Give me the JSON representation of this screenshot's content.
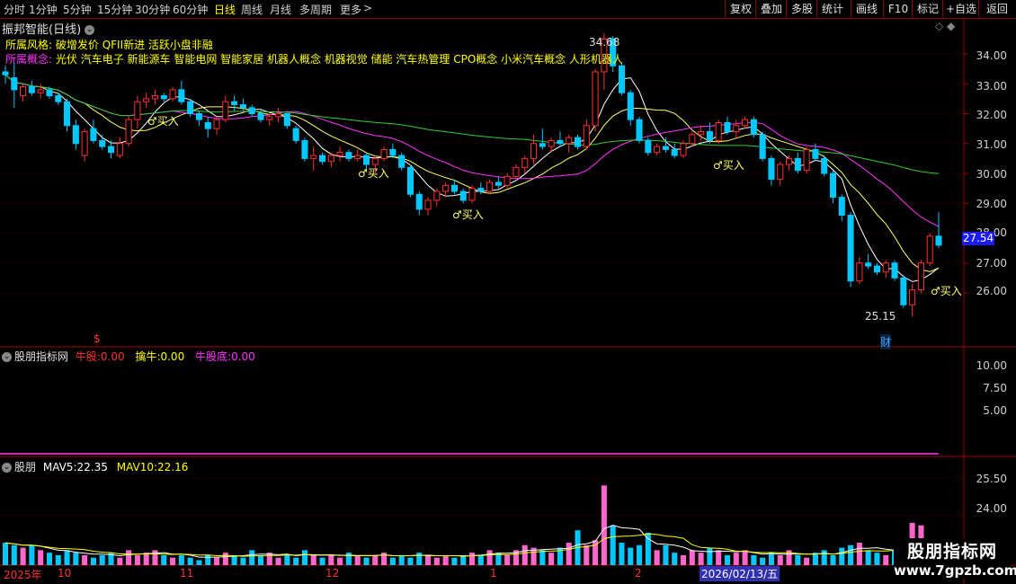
{
  "periods": [
    "分时",
    "1分钟",
    "5分钟",
    "15分钟",
    "30分钟",
    "60分钟",
    "日线",
    "周线",
    "月线",
    "多周期",
    "更多"
  ],
  "active_period": "日线",
  "toolbar": [
    "复权",
    "叠加",
    "多股",
    "统计",
    "画线",
    "F10",
    "标记",
    "+自选",
    "返回"
  ],
  "stock_title": "振邦智能(日线)",
  "style_label": "所属风格:",
  "style_value": "破增发价 QFII新进 活跃小盘非融",
  "concept_label": "所属概念:",
  "concept_value": "光伏 汽车电子 新能源车 智能电网 智能家居 机器人概念 机器视觉 储能 汽车热管理 CPO概念 小米汽车概念 人形机器人",
  "price_axis": [
    "34.00",
    "33.00",
    "32.00",
    "31.00",
    "30.00",
    "29.00",
    "28.00",
    "27.00",
    "26.00"
  ],
  "current_price": "27.54",
  "high_label": "34.68",
  "low_label": "25.15",
  "buy_label": "♂买入",
  "cai_label": "财",
  "s_marker": "$",
  "ind1": {
    "name": "股朋指标网",
    "k1": "牛股:",
    "v1": "0.00",
    "k2": "擒牛:",
    "v2": "0.00",
    "k3": "牛股底:",
    "v3": "0.00",
    "axis": [
      "10.00",
      "7.50",
      "5.00"
    ]
  },
  "ind2": {
    "name": "股朋",
    "k1": "MAV5:",
    "v1": "22.35",
    "k2": "MAV10:",
    "v2": "22.16",
    "axis": [
      "25.50",
      "24.00"
    ]
  },
  "dates": [
    "2025年",
    "10",
    "11",
    "12",
    "1",
    "2",
    "2026/02/13/五"
  ],
  "watermark": {
    "line1": "股朋指标网",
    "line2": "www.7gpzb.com"
  },
  "colors": {
    "up": "#ff3030",
    "down": "#00c8ff",
    "ma_fast": "#ffffff",
    "ma_mid": "#ffff66",
    "ma_slow": "#ff33ff",
    "ma_long": "#33cc33"
  },
  "chart_data": {
    "type": "candlestick",
    "price_range": [
      25.0,
      34.9
    ],
    "candles": [
      [
        33.4,
        33.6,
        33.0,
        33.3
      ],
      [
        33.2,
        33.7,
        32.2,
        32.8
      ],
      [
        32.6,
        33.0,
        32.4,
        32.9
      ],
      [
        32.9,
        33.1,
        32.6,
        32.7
      ],
      [
        32.7,
        33.0,
        32.5,
        32.8
      ],
      [
        32.8,
        32.9,
        32.5,
        32.6
      ],
      [
        32.6,
        32.7,
        32.3,
        32.4
      ],
      [
        32.4,
        32.5,
        31.4,
        31.6
      ],
      [
        31.6,
        31.8,
        30.8,
        31.0
      ],
      [
        30.6,
        31.5,
        30.4,
        31.4
      ],
      [
        31.5,
        31.8,
        31.0,
        31.1
      ],
      [
        31.1,
        31.3,
        30.8,
        30.9
      ],
      [
        30.9,
        31.1,
        30.5,
        30.7
      ],
      [
        30.6,
        31.2,
        30.5,
        31.0
      ],
      [
        31.0,
        31.9,
        30.9,
        31.8
      ],
      [
        31.8,
        32.6,
        31.5,
        32.4
      ],
      [
        32.4,
        32.7,
        32.2,
        32.5
      ],
      [
        32.5,
        32.8,
        32.3,
        32.6
      ],
      [
        32.6,
        32.7,
        32.4,
        32.5
      ],
      [
        32.5,
        32.9,
        32.4,
        32.8
      ],
      [
        32.8,
        33.1,
        32.3,
        32.4
      ],
      [
        32.4,
        32.5,
        31.9,
        32.0
      ],
      [
        32.0,
        32.1,
        31.6,
        31.8
      ],
      [
        31.7,
        31.9,
        31.2,
        31.5
      ],
      [
        31.5,
        31.9,
        31.3,
        31.8
      ],
      [
        31.8,
        32.6,
        31.7,
        32.4
      ],
      [
        32.4,
        32.6,
        32.1,
        32.3
      ],
      [
        32.3,
        32.5,
        32.1,
        32.2
      ],
      [
        32.2,
        32.3,
        31.9,
        32.0
      ],
      [
        32.0,
        32.1,
        31.7,
        31.8
      ],
      [
        31.8,
        32.0,
        31.6,
        31.9
      ],
      [
        31.9,
        32.2,
        31.7,
        32.0
      ],
      [
        32.0,
        32.0,
        31.5,
        31.6
      ],
      [
        31.5,
        31.6,
        31.0,
        31.1
      ],
      [
        31.1,
        31.2,
        30.4,
        30.5
      ],
      [
        30.5,
        30.9,
        30.1,
        30.6
      ],
      [
        30.6,
        30.7,
        30.3,
        30.4
      ],
      [
        30.4,
        30.7,
        30.2,
        30.6
      ],
      [
        30.6,
        30.9,
        30.4,
        30.7
      ],
      [
        30.7,
        30.8,
        30.4,
        30.5
      ],
      [
        30.5,
        30.8,
        30.4,
        30.6
      ],
      [
        30.6,
        30.7,
        30.1,
        30.3
      ],
      [
        30.3,
        30.6,
        30.0,
        30.5
      ],
      [
        30.5,
        30.9,
        30.4,
        30.8
      ],
      [
        30.8,
        31.0,
        30.5,
        30.6
      ],
      [
        30.6,
        30.7,
        30.1,
        30.2
      ],
      [
        30.2,
        30.3,
        29.2,
        29.3
      ],
      [
        29.3,
        29.4,
        28.6,
        28.8
      ],
      [
        28.8,
        29.2,
        28.6,
        29.1
      ],
      [
        29.1,
        29.5,
        28.9,
        29.4
      ],
      [
        29.4,
        29.7,
        29.2,
        29.6
      ],
      [
        29.6,
        29.8,
        29.3,
        29.4
      ],
      [
        29.4,
        29.5,
        29.0,
        29.1
      ],
      [
        29.1,
        29.6,
        29.0,
        29.5
      ],
      [
        29.5,
        29.7,
        29.3,
        29.4
      ],
      [
        29.4,
        29.8,
        29.3,
        29.7
      ],
      [
        29.7,
        29.9,
        29.5,
        29.6
      ],
      [
        29.6,
        30.0,
        29.5,
        29.9
      ],
      [
        29.9,
        30.3,
        29.8,
        30.2
      ],
      [
        30.2,
        30.6,
        30.0,
        30.5
      ],
      [
        30.5,
        31.3,
        30.3,
        31.0
      ],
      [
        31.0,
        31.5,
        30.8,
        30.9
      ],
      [
        30.9,
        31.2,
        30.7,
        31.1
      ],
      [
        31.1,
        31.4,
        30.9,
        31.0
      ],
      [
        31.0,
        31.3,
        30.7,
        31.2
      ],
      [
        31.2,
        31.3,
        30.8,
        30.9
      ],
      [
        30.9,
        31.8,
        30.8,
        31.6
      ],
      [
        31.6,
        33.5,
        31.4,
        33.4
      ],
      [
        33.4,
        34.7,
        32.8,
        34.5
      ],
      [
        34.5,
        34.6,
        33.4,
        33.6
      ],
      [
        33.6,
        33.7,
        32.6,
        32.7
      ],
      [
        32.7,
        32.8,
        31.6,
        31.8
      ],
      [
        31.8,
        31.9,
        31.0,
        31.1
      ],
      [
        31.1,
        31.2,
        30.6,
        30.7
      ],
      [
        30.7,
        31.0,
        30.6,
        30.9
      ],
      [
        30.9,
        31.2,
        30.7,
        30.8
      ],
      [
        30.8,
        31.0,
        30.5,
        30.6
      ],
      [
        30.6,
        31.1,
        30.5,
        31.0
      ],
      [
        31.0,
        31.4,
        30.9,
        31.3
      ],
      [
        31.3,
        31.6,
        31.1,
        31.4
      ],
      [
        31.4,
        31.7,
        31.0,
        31.1
      ],
      [
        31.1,
        31.8,
        31.0,
        31.7
      ],
      [
        31.7,
        31.9,
        31.3,
        31.4
      ],
      [
        31.4,
        31.8,
        31.2,
        31.6
      ],
      [
        31.6,
        31.9,
        31.5,
        31.8
      ],
      [
        31.8,
        31.9,
        31.2,
        31.3
      ],
      [
        31.3,
        31.4,
        30.4,
        30.5
      ],
      [
        30.5,
        30.6,
        29.6,
        29.8
      ],
      [
        29.8,
        30.4,
        29.6,
        30.3
      ],
      [
        30.3,
        30.6,
        30.1,
        30.5
      ],
      [
        30.5,
        30.7,
        30.0,
        30.1
      ],
      [
        30.1,
        30.9,
        30.0,
        30.8
      ],
      [
        30.8,
        31.0,
        30.4,
        30.5
      ],
      [
        30.5,
        30.6,
        29.9,
        30.0
      ],
      [
        30.0,
        30.1,
        29.0,
        29.2
      ],
      [
        29.2,
        29.3,
        28.4,
        28.6
      ],
      [
        28.6,
        28.7,
        26.2,
        26.4
      ],
      [
        26.4,
        27.2,
        26.3,
        27.0
      ],
      [
        27.0,
        27.3,
        26.8,
        26.9
      ],
      [
        26.9,
        27.0,
        26.6,
        26.7
      ],
      [
        26.7,
        27.1,
        26.5,
        27.0
      ],
      [
        27.0,
        27.1,
        26.4,
        26.5
      ],
      [
        26.5,
        26.6,
        25.5,
        25.6
      ],
      [
        25.6,
        26.3,
        25.2,
        26.1
      ],
      [
        26.1,
        27.1,
        26.0,
        27.0
      ],
      [
        27.0,
        28.0,
        26.9,
        27.9
      ],
      [
        27.9,
        28.7,
        27.5,
        27.6
      ]
    ],
    "volumes": [
      22.9,
      22.8,
      22.7,
      22.8,
      22.6,
      22.5,
      22.4,
      22.6,
      22.5,
      22.4,
      22.3,
      22.4,
      22.5,
      22.3,
      22.6,
      22.4,
      22.5,
      22.6,
      22.4,
      22.3,
      22.4,
      22.3,
      22.2,
      22.4,
      22.3,
      22.5,
      22.4,
      22.3,
      22.6,
      22.4,
      22.5,
      22.3,
      22.4,
      22.3,
      22.6,
      22.4,
      22.3,
      22.4,
      22.3,
      22.5,
      22.4,
      22.3,
      22.4,
      22.5,
      22.3,
      22.4,
      22.3,
      22.5,
      22.4,
      22.3,
      22.4,
      22.3,
      22.4,
      22.5,
      22.4,
      22.6,
      22.5,
      22.4,
      22.6,
      22.8,
      22.7,
      22.6,
      22.5,
      22.7,
      22.9,
      23.4,
      22.8,
      23.0,
      25.2,
      23.6,
      22.9,
      22.7,
      22.8,
      23.3,
      22.6,
      22.8,
      22.5,
      22.4,
      22.6,
      22.5,
      22.7,
      22.6,
      22.4,
      22.5,
      22.6,
      22.4,
      22.3,
      22.5,
      22.4,
      22.6,
      22.4,
      22.3,
      22.5,
      22.6,
      22.4,
      22.7,
      22.8,
      22.9,
      22.6,
      22.5,
      22.4,
      22.6,
      22.5,
      23.7,
      23.6,
      22.4
    ]
  }
}
